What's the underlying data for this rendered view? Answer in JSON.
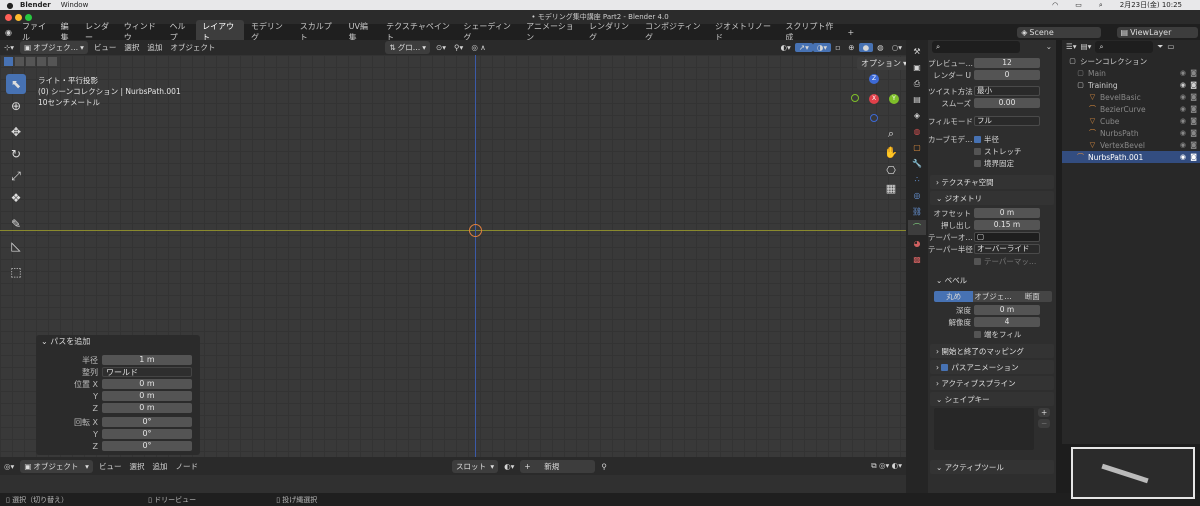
{
  "macbar": {
    "app": "Blender",
    "window_menu": "Window",
    "datetime": "2月23日(金)  10:25"
  },
  "title": "• モデリング集中講座 Part2 - Blender 4.0",
  "menus": [
    "ファイル",
    "編集",
    "レンダー",
    "ウィンドウ",
    "ヘルプ"
  ],
  "workspaces": [
    "レイアウト",
    "モデリング",
    "スカルプト",
    "UV編集",
    "テクスチャペイント",
    "シェーディング",
    "アニメーション",
    "レンダリング",
    "コンポジティング",
    "ジオメトリノード",
    "スクリプト作成"
  ],
  "active_workspace": "レイアウト",
  "scene": "Scene",
  "view_layer": "ViewLayer",
  "viewport_header": {
    "mode": "オブジェク…",
    "menus": [
      "ビュー",
      "選択",
      "追加",
      "オブジェクト"
    ],
    "transform": "グロ…",
    "options": "オプション"
  },
  "viewport_info": [
    "ライト・平行投影",
    "(0) シーンコレクション | NurbsPath.001",
    "10センチメートル"
  ],
  "gizmo": {
    "z": "Z",
    "x": "X",
    "y": "Y"
  },
  "operator_panel": {
    "title": "パスを追加",
    "rows": [
      {
        "label": "半径",
        "value": "1 m"
      },
      {
        "label": "整列",
        "value": "ワールド"
      },
      {
        "label": "位置 X",
        "value": "0 m"
      },
      {
        "label": "Y",
        "value": "0 m"
      },
      {
        "label": "Z",
        "value": "0 m"
      },
      {
        "label": "回転 X",
        "value": "0°"
      },
      {
        "label": "Y",
        "value": "0°"
      },
      {
        "label": "Z",
        "value": "0°"
      }
    ]
  },
  "bottom_header": {
    "mode": "オブジェクト",
    "menus": [
      "ビュー",
      "選択",
      "追加",
      "ノード"
    ],
    "slot": "スロット",
    "new": "新規"
  },
  "statusbar": [
    "選択（切り替え）",
    "ドリービュー",
    "投げ縄選択"
  ],
  "properties": {
    "preview_label": "プレビュー…",
    "preview_value": "12",
    "render_u_label": "レンダー U",
    "render_u_value": "0",
    "twist_label": "ツイスト方法",
    "twist_value": "最小",
    "smooth_label": "スムーズ",
    "smooth_value": "0.00",
    "fillmode_label": "フィルモード",
    "fillmode_value": "フル",
    "curve_label": "カーブモデ…",
    "radius_chk": "半径",
    "stretch_chk": "ストレッチ",
    "bounds_chk": "境界固定",
    "texspace": "テクスチャ空間",
    "geometry": "ジオメトリ",
    "offset_label": "オフセット",
    "offset_value": "0 m",
    "extrude_label": "押し出し",
    "extrude_value": "0.15 m",
    "taper_obj_label": "テーパーオ…",
    "taper_rad_label": "テーパー半径",
    "taper_rad_value": "オーバーライド",
    "taper_map": "テーパーマッ…",
    "bevel": "ベベル",
    "bevel_tabs": [
      "丸め",
      "オブジェ…",
      "断面"
    ],
    "depth_label": "深度",
    "depth_value": "0 m",
    "res_label": "解像度",
    "res_value": "4",
    "fillcaps": "端をフィル",
    "startend": "開始と終了のマッピング",
    "pathanim": "パスアニメーション",
    "activespline": "アクティブスプライン",
    "shapekeys": "シェイプキー",
    "activetool": "アクティブツール"
  },
  "outliner": {
    "root": "シーンコレクション",
    "items": [
      {
        "name": "Main",
        "depth": 1,
        "icon": "collection-icon"
      },
      {
        "name": "Training",
        "depth": 1,
        "icon": "collection-icon"
      },
      {
        "name": "BevelBasic",
        "depth": 2,
        "icon": "mesh-icon"
      },
      {
        "name": "BezierCurve",
        "depth": 2,
        "icon": "curve-icon"
      },
      {
        "name": "Cube",
        "depth": 2,
        "icon": "mesh-icon"
      },
      {
        "name": "NurbsPath",
        "depth": 2,
        "icon": "curve-icon"
      },
      {
        "name": "VertexBevel",
        "depth": 2,
        "icon": "mesh-icon"
      },
      {
        "name": "NurbsPath.001",
        "depth": 1,
        "icon": "curve-icon"
      }
    ],
    "selected": "NurbsPath.001"
  },
  "colors": {
    "accent": "#4772b3",
    "x_axis": "#8a8a2e",
    "y_axis": "#3b5aa8"
  }
}
